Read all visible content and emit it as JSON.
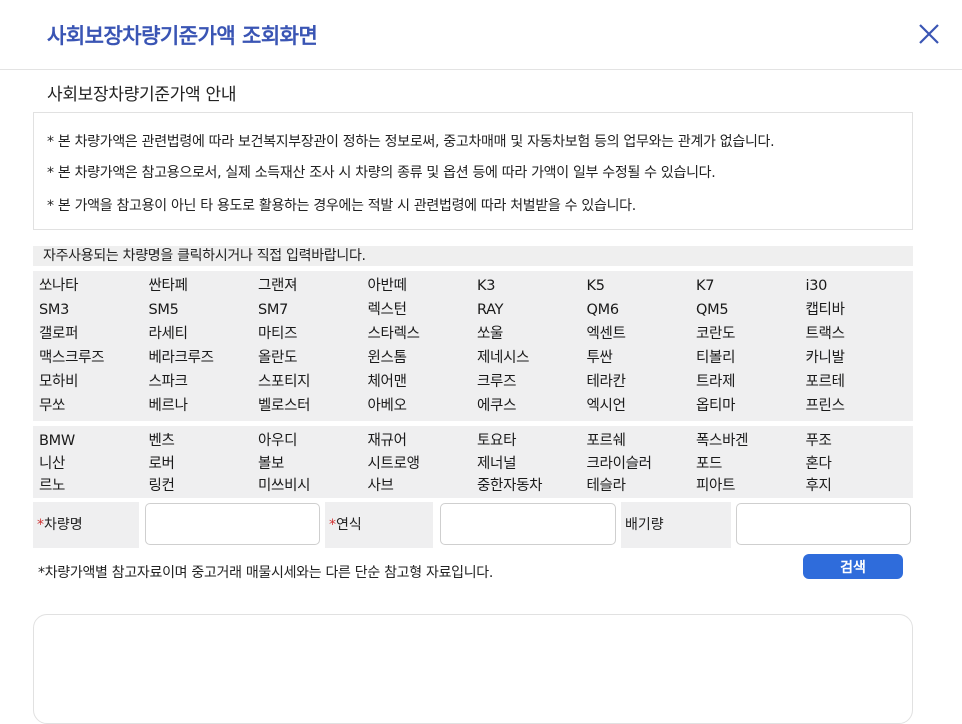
{
  "header": {
    "title": "사회보장차량기준가액 조회화면"
  },
  "section": {
    "title": "사회보장차량기준가액 안내"
  },
  "notices": [
    "* 본 차량가액은 관련법령에 따라 보건복지부장관이 정하는 정보로써, 중고차매매 및 자동차보험 등의 업무와는 관계가 없습니다.",
    "* 본 차량가액은 참고용으로서, 실제 소득재산 조사 시 차량의 종류 및 옵션 등에 따라 가액이 일부 수정될 수 있습니다.",
    "* 본 가액을 참고용이 아닌 타 용도로 활용하는 경우에는 적발 시 관련법령에 따라 처벌받을 수 있습니다."
  ],
  "hint": "자주사용되는 차량명을 클릭하시거나 직접 입력바랍니다.",
  "domestic_cars": [
    "쏘나타",
    "싼타페",
    "그랜져",
    "아반떼",
    "K3",
    "K5",
    "K7",
    "i30",
    "SM3",
    "SM5",
    "SM7",
    "렉스턴",
    "RAY",
    "QM6",
    "QM5",
    "캡티바",
    "갤로퍼",
    "라세티",
    "마티즈",
    "스타렉스",
    "쏘울",
    "엑센트",
    "코란도",
    "트랙스",
    "맥스크루즈",
    "베라크루즈",
    "올란도",
    "윈스톰",
    "제네시스",
    "투싼",
    "티볼리",
    "카니발",
    "모하비",
    "스파크",
    "스포티지",
    "체어맨",
    "크루즈",
    "테라칸",
    "트라제",
    "포르테",
    "무쏘",
    "베르나",
    "벨로스터",
    "아베오",
    "에쿠스",
    "엑시언",
    "옵티마",
    "프린스"
  ],
  "imported_cars": [
    "BMW",
    "벤츠",
    "아우디",
    "재규어",
    "토요타",
    "포르쉐",
    "폭스바겐",
    "푸조",
    "니산",
    "로버",
    "볼보",
    "시트로앵",
    "제너널",
    "크라이슬러",
    "포드",
    "혼다",
    "르노",
    "링컨",
    "미쓰비시",
    "사브",
    "중한자동차",
    "테슬라",
    "피아트",
    "후지"
  ],
  "form": {
    "car_name_label": "차량명",
    "year_label": "연식",
    "displacement_label": "배기량",
    "required_mark": "*",
    "car_name_value": "",
    "year_value": "",
    "displacement_value": ""
  },
  "footnote": "*차량가액별 참고자료이며 중고거래 매물시세와는 다른 단순 참고형 자료입니다.",
  "search_label": "검색",
  "colors": {
    "accent": "#3a55b4",
    "button": "#2f6cdb",
    "required": "#d03030"
  },
  "icons": {
    "close": "close-icon"
  }
}
